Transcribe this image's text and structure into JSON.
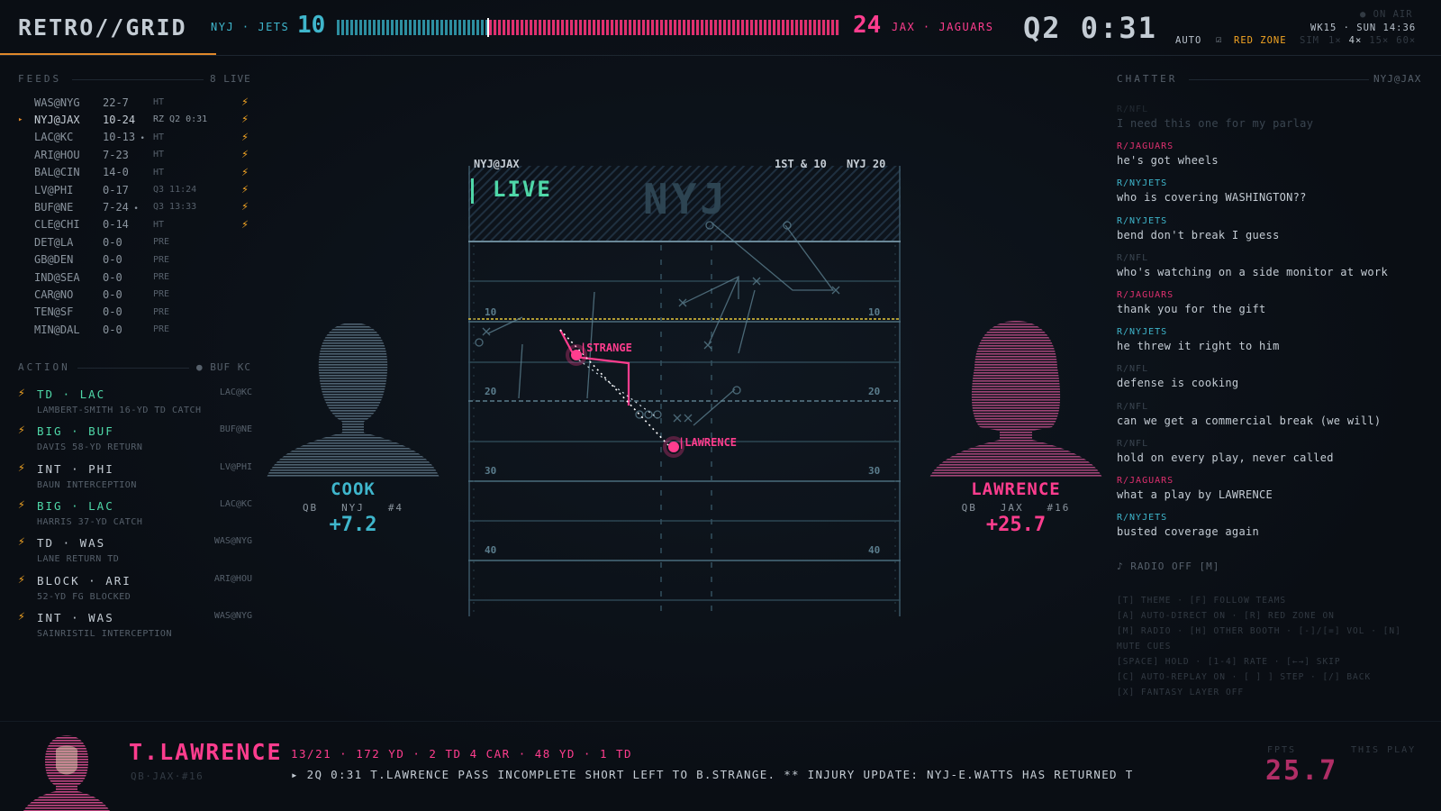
{
  "header": {
    "brand": "RETRO//GRID",
    "home_abbr": "NYJ · JETS",
    "home_score": "10",
    "away_score": "24",
    "away_abbr": "JAX · JAGUARS",
    "home_win_fraction": 0.3,
    "clock": "Q2 0:31",
    "on_air": "● ON AIR",
    "week_time": "WK15 · SUN 14:36",
    "auto_label": "AUTO",
    "redzone_check": "☑",
    "redzone_label": "RED ZONE",
    "sim_label": "SIM",
    "rates": [
      "1×",
      "4×",
      "15×",
      "60×"
    ],
    "active_rate_index": 1
  },
  "feeds": {
    "title": "FEEDS",
    "live_count": "8 LIVE",
    "items": [
      {
        "game": "WAS@NYG",
        "score": "22-7",
        "status": "HT",
        "bolt": true,
        "active": false,
        "dot": false
      },
      {
        "game": "NYJ@JAX",
        "score": "10-24",
        "status": "RZ Q2 0:31",
        "bolt": true,
        "active": true,
        "dot": false
      },
      {
        "game": "LAC@KC",
        "score": "10-13",
        "status": "HT",
        "bolt": true,
        "active": false,
        "dot": true
      },
      {
        "game": "ARI@HOU",
        "score": "7-23",
        "status": "HT",
        "bolt": true,
        "active": false,
        "dot": false
      },
      {
        "game": "BAL@CIN",
        "score": "14-0",
        "status": "HT",
        "bolt": true,
        "active": false,
        "dot": false
      },
      {
        "game": "LV@PHI",
        "score": "0-17",
        "status": "Q3 11:24",
        "bolt": true,
        "active": false,
        "dot": false
      },
      {
        "game": "BUF@NE",
        "score": "7-24",
        "status": "Q3 13:33",
        "bolt": true,
        "active": false,
        "dot": true
      },
      {
        "game": "CLE@CHI",
        "score": "0-14",
        "status": "HT",
        "bolt": true,
        "active": false,
        "dot": false
      },
      {
        "game": "DET@LA",
        "score": "0-0",
        "status": "PRE",
        "bolt": false,
        "active": false,
        "dot": false
      },
      {
        "game": "GB@DEN",
        "score": "0-0",
        "status": "PRE",
        "bolt": false,
        "active": false,
        "dot": false
      },
      {
        "game": "IND@SEA",
        "score": "0-0",
        "status": "PRE",
        "bolt": false,
        "active": false,
        "dot": false
      },
      {
        "game": "CAR@NO",
        "score": "0-0",
        "status": "PRE",
        "bolt": false,
        "active": false,
        "dot": false
      },
      {
        "game": "TEN@SF",
        "score": "0-0",
        "status": "PRE",
        "bolt": false,
        "active": false,
        "dot": false
      },
      {
        "game": "MIN@DAL",
        "score": "0-0",
        "status": "PRE",
        "bolt": false,
        "active": false,
        "dot": false
      }
    ]
  },
  "action": {
    "title": "ACTION",
    "filter": "● BUF KC",
    "items": [
      {
        "title": "TD · LAC",
        "color": "#4fd8a8",
        "game": "LAC@KC",
        "desc": "LAMBERT-SMITH 16-YD TD CATCH"
      },
      {
        "title": "BIG · BUF",
        "color": "#4fd8a8",
        "game": "BUF@NE",
        "desc": "DAVIS 58-YD RETURN"
      },
      {
        "title": "INT · PHI",
        "color": "#c4ccd4",
        "game": "LV@PHI",
        "desc": "BAUN INTERCEPTION"
      },
      {
        "title": "BIG · LAC",
        "color": "#4fd8a8",
        "game": "LAC@KC",
        "desc": "HARRIS 37-YD CATCH"
      },
      {
        "title": "TD · WAS",
        "color": "#c4ccd4",
        "game": "WAS@NYG",
        "desc": "LANE RETURN TD"
      },
      {
        "title": "BLOCK · ARI",
        "color": "#c4ccd4",
        "game": "ARI@HOU",
        "desc": "52-YD FG BLOCKED"
      },
      {
        "title": "INT · WAS",
        "color": "#c4ccd4",
        "game": "WAS@NYG",
        "desc": "SAINRISTIL INTERCEPTION"
      }
    ]
  },
  "field": {
    "game": "NYJ@JAX",
    "down": "1ST & 10",
    "spot": "NYJ 20",
    "live": "LIVE",
    "endzone": "NYJ",
    "yard_labels": [
      "10",
      "20",
      "30",
      "40"
    ],
    "receiver_label": "STRANGE",
    "qb_label": "LAWRENCE"
  },
  "players": {
    "left": {
      "name": "COOK",
      "pos": "QB",
      "team": "NYJ",
      "num": "#4",
      "score": "+7.2"
    },
    "right": {
      "name": "LAWRENCE",
      "pos": "QB",
      "team": "JAX",
      "num": "#16",
      "score": "+25.7"
    }
  },
  "chatter": {
    "title": "CHATTER",
    "game": "NYJ@JAX",
    "messages": [
      {
        "user": "R/NFL",
        "text": "I need this one for my parlay",
        "faded": true
      },
      {
        "user": "R/JAGUARS",
        "text": "he's got wheels",
        "faded": false
      },
      {
        "user": "R/NYJETS",
        "text": "who is covering WASHINGTON??",
        "faded": false
      },
      {
        "user": "R/NYJETS",
        "text": "bend don't break I guess",
        "faded": false
      },
      {
        "user": "R/NFL",
        "text": "who's watching on a side monitor at work",
        "faded": false
      },
      {
        "user": "R/JAGUARS",
        "text": "thank you for the gift",
        "faded": false
      },
      {
        "user": "R/NYJETS",
        "text": "he threw it right to him",
        "faded": false
      },
      {
        "user": "R/NFL",
        "text": "defense is cooking",
        "faded": false
      },
      {
        "user": "R/NFL",
        "text": "can we get a commercial break (we will)",
        "faded": false
      },
      {
        "user": "R/NFL",
        "text": "hold on every play, never called",
        "faded": false
      },
      {
        "user": "R/JAGUARS",
        "text": "what a play by LAWRENCE",
        "faded": false
      },
      {
        "user": "R/NYJETS",
        "text": "busted coverage again",
        "faded": false
      }
    ],
    "radio": "♪ RADIO OFF  [M]",
    "help": [
      "[T] THEME · [F] FOLLOW TEAMS",
      "[A] AUTO-DIRECT ON · [R] RED ZONE ON",
      "[M] RADIO · [H] OTHER BOOTH · [-]/[=] VOL · [N]",
      "MUTE CUES",
      "[SPACE] HOLD · [1-4] RATE · [←→] SKIP",
      "[C] AUTO-REPLAY ON · [ ] ] STEP · [/] BACK",
      "[X] FANTASY LAYER OFF"
    ]
  },
  "bottom": {
    "name": "T.LAWRENCE",
    "meta": "QB·JAX·#16",
    "stats": "13/21 · 172 YD · 2 TD 4 CAR · 48 YD · 1 TD",
    "ticker": "▸ 2Q 0:31 T.LAWRENCE PASS INCOMPLETE SHORT LEFT TO B.STRANGE. ** INJURY UPDATE: NYJ-E.WATTS HAS RETURNED T",
    "fpts_label": "FPTS",
    "fpts": "25.7",
    "this_play": "THIS PLAY"
  },
  "colors": {
    "cyan": "#3fb6cc",
    "pink": "#ff3d8e",
    "orange": "#f5a623",
    "green": "#4fd8a8",
    "yellow": "#e5c83a"
  }
}
